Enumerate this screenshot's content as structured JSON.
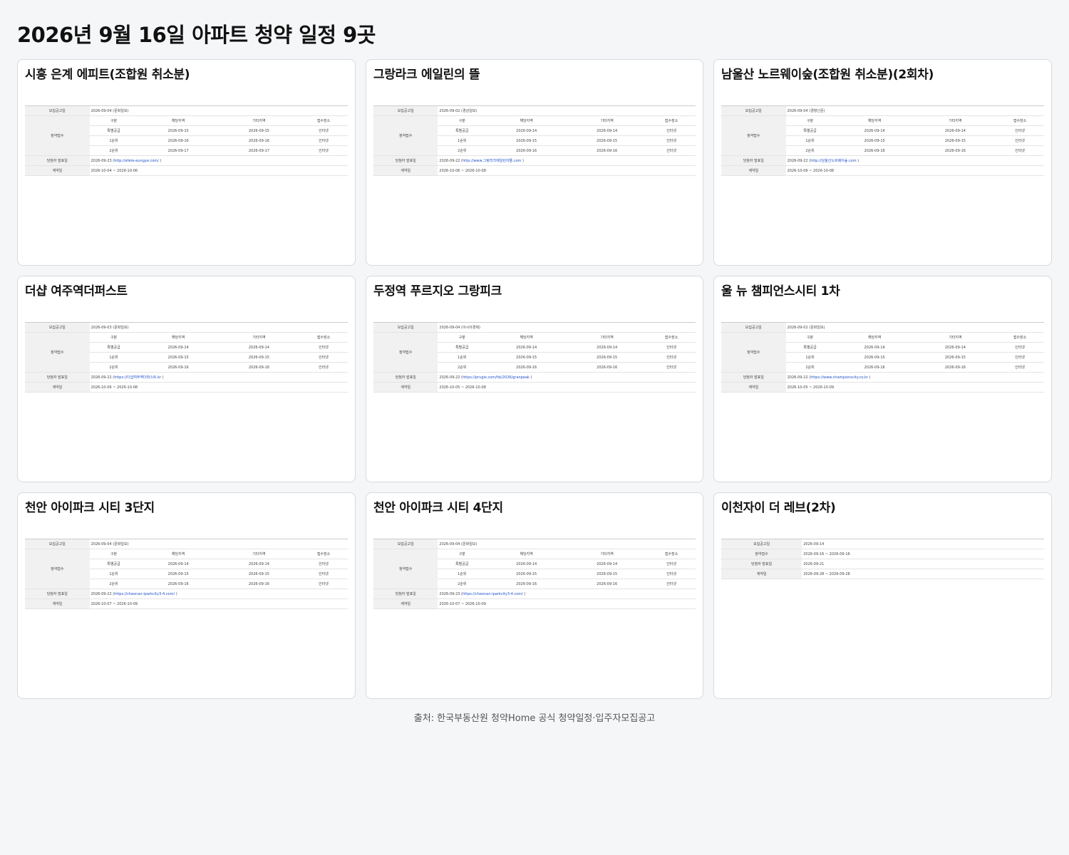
{
  "page": {
    "title": "2026년 9월 16일 아파트 청약 일정 9곳",
    "footer": "출처: 한국부동산원 청약Home 공식 청약일정·입주자모집공고"
  },
  "labels": {
    "announce": "모집공고일",
    "subscribe": "청약접수",
    "winners": "당첨자 발표일",
    "contract": "계약일",
    "col_type": "구분",
    "col_local": "해당지역",
    "col_other": "기타지역",
    "col_place": "접수장소",
    "simple_subscribe": "청약접수",
    "simple_winners": "당첨자 발표일"
  },
  "cards": [
    {
      "title": "시흥 은계 에피트(조합원 취소분)",
      "announce": "2026-09-04 (문화일보)",
      "rows": [
        {
          "type": "특별공급",
          "local": "2026-09-15",
          "other": "2026-09-15",
          "place": "인터넷"
        },
        {
          "type": "1순위",
          "local": "2026-09-16",
          "other": "2026-09-16",
          "place": "인터넷"
        },
        {
          "type": "2순위",
          "local": "2026-09-17",
          "other": "2026-09-17",
          "place": "인터넷"
        }
      ],
      "winners_date": "2026-09-23 (",
      "winners_url": "http://efete-eungye.com/",
      "winners_close": " )",
      "contract": "2026-10-04 ~ 2026-10-06"
    },
    {
      "title": "그랑라크 에일린의 뜰",
      "announce": "2026-09-02 (경상일보)",
      "rows": [
        {
          "type": "특별공급",
          "local": "2026-09-14",
          "other": "2026-09-14",
          "place": "인터넷"
        },
        {
          "type": "1순위",
          "local": "2026-09-15",
          "other": "2026-09-15",
          "place": "인터넷"
        },
        {
          "type": "2순위",
          "local": "2026-09-16",
          "other": "2026-09-16",
          "place": "인터넷"
        }
      ],
      "winners_date": "2026-09-22 (",
      "winners_url": "http://www.그랑라크에일린의뜰.com",
      "winners_close": " )",
      "contract": "2026-10-06 ~ 2026-10-08"
    },
    {
      "title": "남울산 노르웨이숲(조합원 취소분)(2회차)",
      "announce": "2026-09-04 (경향신문)",
      "rows": [
        {
          "type": "특별공급",
          "local": "2026-09-14",
          "other": "2026-09-14",
          "place": "인터넷"
        },
        {
          "type": "1순위",
          "local": "2026-09-15",
          "other": "2026-09-15",
          "place": "인터넷"
        },
        {
          "type": "2순위",
          "local": "2026-09-16",
          "other": "2026-09-16",
          "place": "인터넷"
        }
      ],
      "winners_date": "2026-09-22 (",
      "winners_url": "http://남울산노르웨이숲.com",
      "winners_close": " )",
      "contract": "2026-10-06 ~ 2026-10-08"
    },
    {
      "title": "더샵 여주역더퍼스트",
      "announce": "2026-09-03 (문화일보)",
      "rows": [
        {
          "type": "특별공급",
          "local": "2026-09-14",
          "other": "2026-09-14",
          "place": "인터넷"
        },
        {
          "type": "1순위",
          "local": "2026-09-15",
          "other": "2026-09-15",
          "place": "인터넷"
        },
        {
          "type": "2순위",
          "local": "2026-09-16",
          "other": "2026-09-16",
          "place": "인터넷"
        }
      ],
      "winners_date": "2026-09-22 (",
      "winners_url": "https://더샵여주역더퍼스트.kr",
      "winners_close": " )",
      "contract": "2026-10-06 ~ 2026-10-08"
    },
    {
      "title": "두정역 푸르지오 그랑피크",
      "announce": "2026-09-04 (아시아경제)",
      "rows": [
        {
          "type": "특별공급",
          "local": "2026-09-14",
          "other": "2026-09-14",
          "place": "인터넷"
        },
        {
          "type": "1순위",
          "local": "2026-09-15",
          "other": "2026-09-15",
          "place": "인터넷"
        },
        {
          "type": "2순위",
          "local": "2026-09-16",
          "other": "2026-09-16",
          "place": "인터넷"
        }
      ],
      "winners_date": "2026-09-22 (",
      "winners_url": "https://prugio.com/hb/2026/granpeak",
      "winners_close": " )",
      "contract": "2026-10-05 ~ 2026-10-08"
    },
    {
      "title": "울 뉴 챔피언스시티 1차",
      "announce": "2026-09-02 (문화일보)",
      "rows": [
        {
          "type": "특별공급",
          "local": "2026-09-14",
          "other": "2026-09-14",
          "place": "인터넷"
        },
        {
          "type": "1순위",
          "local": "2026-09-15",
          "other": "2026-09-15",
          "place": "인터넷"
        },
        {
          "type": "2순위",
          "local": "2026-09-16",
          "other": "2026-09-16",
          "place": "인터넷"
        }
      ],
      "winners_date": "2026-09-22 (",
      "winners_url": "https://www.championscity.co.kr",
      "winners_close": " )",
      "contract": "2026-10-05 ~ 2026-10-09"
    },
    {
      "title": "천안 아이파크 시티 3단지",
      "announce": "2026-09-04 (문화일보)",
      "rows": [
        {
          "type": "특별공급",
          "local": "2026-09-14",
          "other": "2026-09-14",
          "place": "인터넷"
        },
        {
          "type": "1순위",
          "local": "2026-09-15",
          "other": "2026-09-15",
          "place": "인터넷"
        },
        {
          "type": "2순위",
          "local": "2026-09-16",
          "other": "2026-09-16",
          "place": "인터넷"
        }
      ],
      "winners_date": "2026-09-22 (",
      "winners_url": "https://cheonan-iparkcity3-4.com/",
      "winners_close": " )",
      "contract": "2026-10-07 ~ 2026-10-09"
    },
    {
      "title": "천안 아이파크 시티 4단지",
      "announce": "2026-09-04 (문화일보)",
      "rows": [
        {
          "type": "특별공급",
          "local": "2026-09-14",
          "other": "2026-09-14",
          "place": "인터넷"
        },
        {
          "type": "1순위",
          "local": "2026-09-15",
          "other": "2026-09-15",
          "place": "인터넷"
        },
        {
          "type": "2순위",
          "local": "2026-09-16",
          "other": "2026-09-16",
          "place": "인터넷"
        }
      ],
      "winners_date": "2026-09-23 (",
      "winners_url": "https://cheonan-iparkcity3-4.com/",
      "winners_close": " )",
      "contract": "2026-10-07 ~ 2026-10-09"
    }
  ],
  "simple_card": {
    "title": "이천자이 더 레브(2차)",
    "announce": "2026-09-14",
    "subscribe": "2026-09-16 ~ 2026-09-16",
    "winners": "2026-09-21",
    "contract": "2026-09-28 ~ 2026-09-28"
  }
}
